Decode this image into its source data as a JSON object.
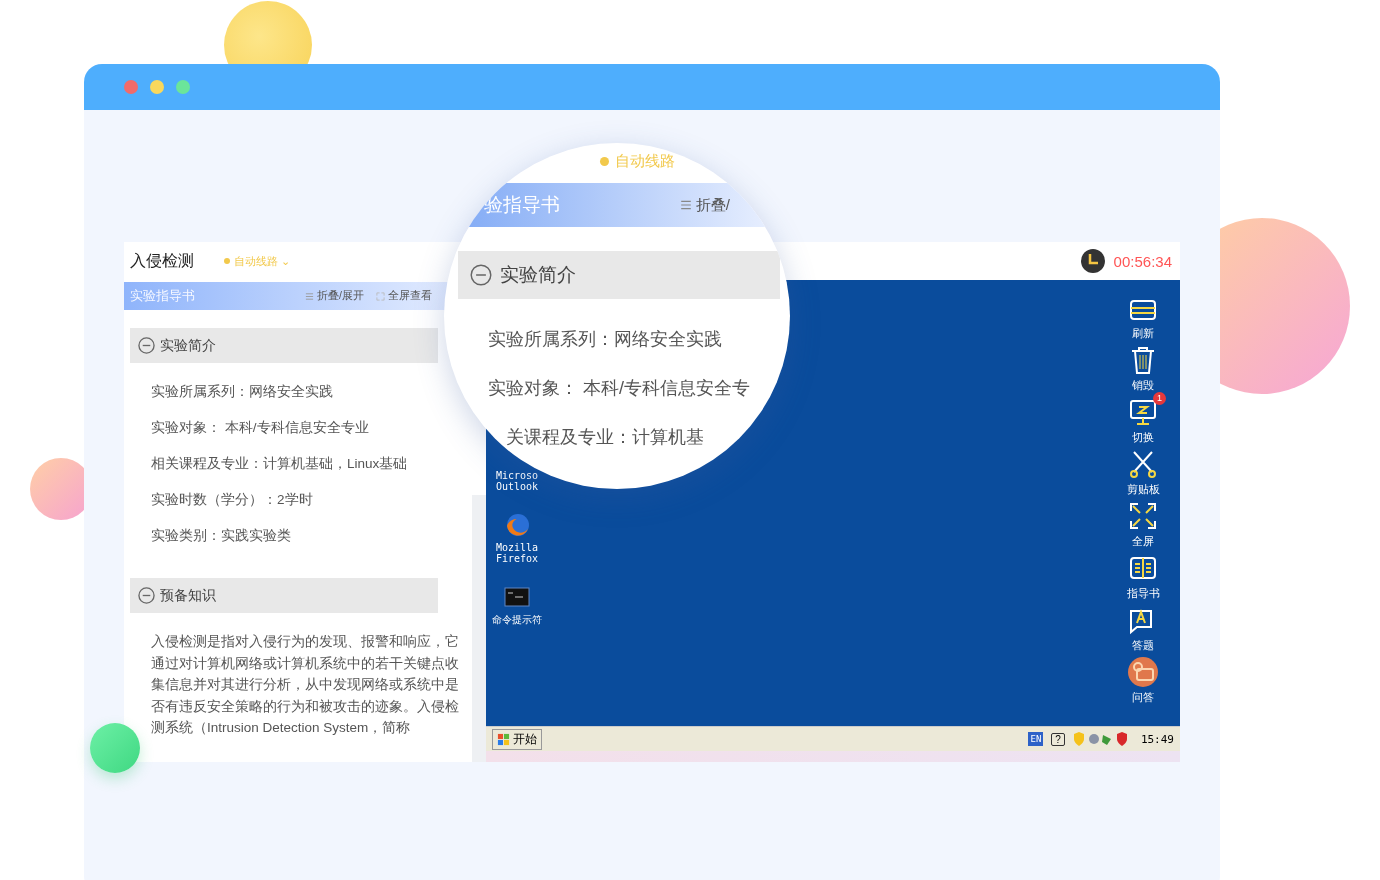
{
  "app": {
    "title": "入侵检测",
    "route": {
      "label": "自动线路",
      "caret": "⌄"
    },
    "timer": "00:56:34"
  },
  "guide": {
    "title": "实验指导书",
    "actions": [
      {
        "kind": "collapse",
        "label": "折叠/展开"
      },
      {
        "kind": "fullscreen",
        "label": "全屏查看"
      }
    ],
    "sections": [
      {
        "title": "实验简介",
        "expanded": true,
        "items": [
          "实验所属系列：网络安全实践",
          "实验对象：  本科/专科信息安全专业",
          "相关课程及专业：计算机基础，Linux基础",
          "实验时数（学分）：2学时",
          "实验类别：实践实验类"
        ]
      },
      {
        "title": "预备知识",
        "expanded": true,
        "paragraph": "入侵检测是指对入侵行为的发现、报警和响应，它通过对计算机网络或计算机系统中的若干关键点收集信息并对其进行分析，从中发现网络或系统中是否有违反安全策略的行为和被攻击的迹象。入侵检测系统（Intrusion Detection System，简称"
      }
    ]
  },
  "desktop": {
    "icons": [
      {
        "kind": "outlook",
        "label": "Microso\nOutlook"
      },
      {
        "kind": "firefox",
        "label": "Mozilla\nFirefox"
      },
      {
        "kind": "cmd",
        "label": "命令提示符"
      }
    ],
    "toolbar": [
      {
        "kind": "refresh",
        "label": "刷新"
      },
      {
        "kind": "trash",
        "label": "销毁"
      },
      {
        "kind": "switch",
        "label": "切换",
        "badge": "1"
      },
      {
        "kind": "scissors",
        "label": "剪贴板"
      },
      {
        "kind": "fullscreen",
        "label": "全屏"
      },
      {
        "kind": "book",
        "label": "指导书"
      },
      {
        "kind": "answer",
        "label": "答题"
      },
      {
        "kind": "qa",
        "label": "问答"
      }
    ],
    "taskbar": {
      "start": "开始",
      "lang": "EN",
      "help": "?",
      "clock": "15:49"
    }
  },
  "magnifier": {
    "route": "自动线路",
    "guide_title": "验指导书",
    "action": "折叠/",
    "section": "实验简介",
    "lines": [
      "实验所属系列：网络安全实践",
      "实验对象：  本科/专科信息安全专",
      "关课程及专业：计算机基"
    ]
  }
}
